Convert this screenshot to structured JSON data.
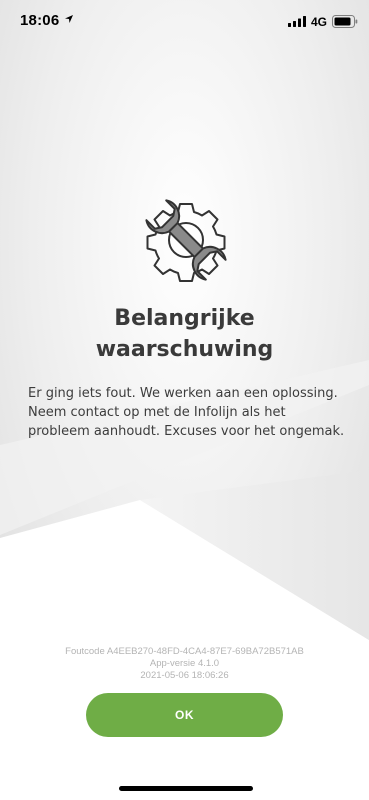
{
  "status_bar": {
    "time": "18:06",
    "network": "4G"
  },
  "error_screen": {
    "title": "Belangrijke waarschuwing",
    "message": "Er ging iets fout. We werken aan een oplossing. Neem contact op met de Infolijn als het probleem aanhoudt. Excuses voor het ongemak.",
    "error_code": "Foutcode A4EEB270-48FD-4CA4-87E7-69BA72B571AB",
    "app_version": "App-versie 4.1.0",
    "timestamp": "2021-05-06 18:06:26",
    "ok_label": "OK"
  },
  "icons": {
    "illustration": "gear-wrench-icon",
    "location": "location-arrow-icon",
    "signal": "signal-bars-icon",
    "battery": "battery-icon"
  },
  "colors": {
    "accent": "#6fad46",
    "icon_fill": "#8a8a8a",
    "title": "#3a3a3a",
    "meta_text": "#b4b4b4"
  }
}
